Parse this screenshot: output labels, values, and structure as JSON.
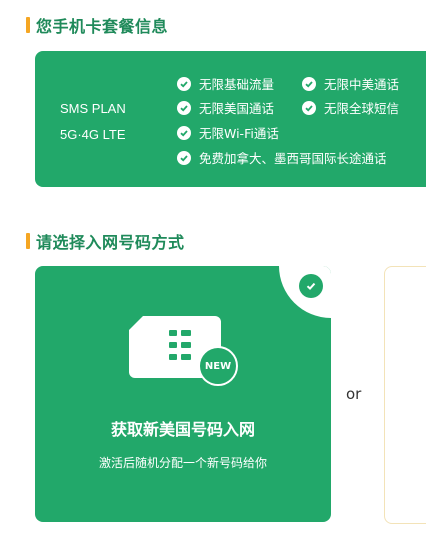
{
  "plan_section": {
    "title": "您手机卡套餐信息",
    "plan_name_line1": "SMS PLAN",
    "plan_name_line2": "5G·4G LTE",
    "features": [
      "无限基础流量",
      "无限中美通话",
      "无限美国通话",
      "无限全球短信",
      "无限Wi-Fi通话",
      "免费加拿大、墨西哥国际长途通话"
    ]
  },
  "number_section": {
    "title": "请选择入网号码方式",
    "option_new": {
      "badge": "NEW",
      "title": "获取新美国号码入网",
      "desc": "激活后随机分配一个新号码给你"
    },
    "or_label": "or"
  },
  "colors": {
    "primary_green": "#22a86a",
    "title_green": "#1f8a5a",
    "accent_orange": "#f5a623"
  }
}
